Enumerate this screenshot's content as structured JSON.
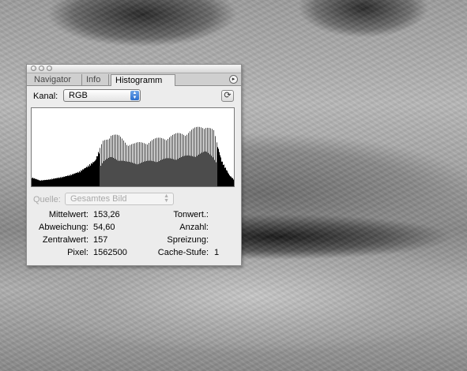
{
  "palette": {
    "tabs": [
      {
        "label": "Navigator",
        "active": false
      },
      {
        "label": "Info",
        "active": false
      },
      {
        "label": "Histogramm",
        "active": true
      }
    ],
    "channel": {
      "label": "Kanal:",
      "value": "RGB"
    },
    "source": {
      "label": "Quelle:",
      "value": "Gesamtes Bild",
      "enabled": false
    },
    "stats_left": [
      {
        "label": "Mittelwert:",
        "value": "153,26"
      },
      {
        "label": "Abweichung:",
        "value": "54,60"
      },
      {
        "label": "Zentralwert:",
        "value": "157"
      },
      {
        "label": "Pixel:",
        "value": "1562500"
      }
    ],
    "stats_right": [
      {
        "label": "Tonwert.:",
        "value": ""
      },
      {
        "label": "Anzahl:",
        "value": ""
      },
      {
        "label": "Spreizung:",
        "value": ""
      },
      {
        "label": "Cache-Stufe:",
        "value": "1"
      }
    ],
    "icons": {
      "refresh": "refresh-icon",
      "panel_menu": "palette-menu-icon"
    },
    "colors": {
      "histogram_fill": "#000000",
      "accent": "#2b6fcf"
    }
  },
  "chart_data": {
    "type": "bar",
    "title": "",
    "xlabel": "",
    "ylabel": "",
    "xlim": [
      0,
      255
    ],
    "ylim": [
      0,
      1
    ],
    "note_values_relative": true,
    "envelope_x": [
      0,
      10,
      20,
      30,
      40,
      50,
      60,
      70,
      80,
      90,
      100,
      110,
      120,
      130,
      140,
      150,
      160,
      170,
      180,
      190,
      200,
      210,
      220,
      230,
      240,
      250,
      255
    ],
    "envelope_y": [
      0.12,
      0.08,
      0.09,
      0.11,
      0.13,
      0.16,
      0.2,
      0.27,
      0.35,
      0.62,
      0.72,
      0.68,
      0.6,
      0.58,
      0.6,
      0.63,
      0.65,
      0.68,
      0.7,
      0.73,
      0.76,
      0.8,
      0.85,
      0.75,
      0.35,
      0.15,
      0.1
    ]
  }
}
